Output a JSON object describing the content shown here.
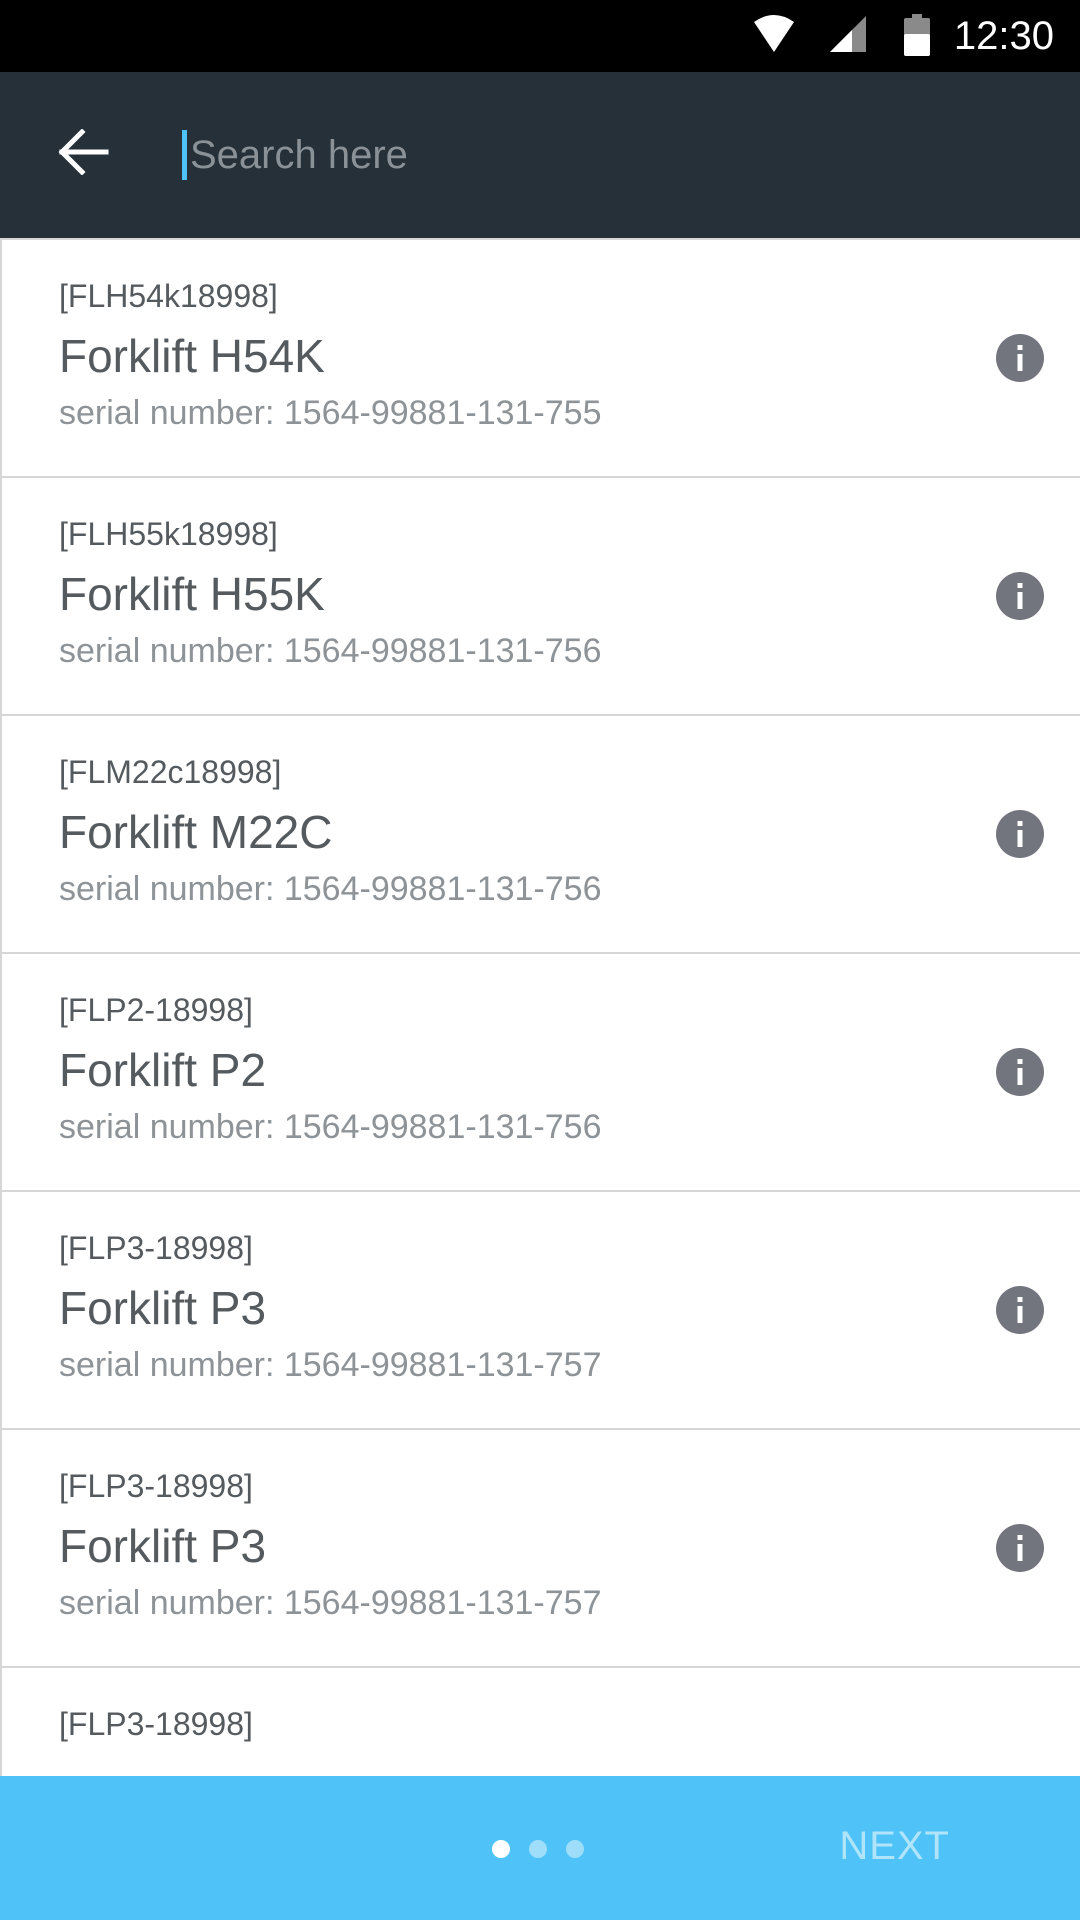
{
  "status_bar": {
    "time": "12:30",
    "icons": [
      "wifi-icon",
      "cell-signal-icon",
      "battery-icon"
    ]
  },
  "search": {
    "placeholder": "Search here",
    "value": "",
    "back_icon": "arrow-back-icon"
  },
  "items": [
    {
      "code": "[FLH54k18998]",
      "name": "Forklift H54K",
      "serial": "serial number: 1564-99881-131-755"
    },
    {
      "code": "[FLH55k18998]",
      "name": "Forklift H55K",
      "serial": "serial number: 1564-99881-131-756"
    },
    {
      "code": "[FLM22c18998]",
      "name": "Forklift M22C",
      "serial": "serial number: 1564-99881-131-756"
    },
    {
      "code": "[FLP2-18998]",
      "name": "Forklift P2",
      "serial": "serial number: 1564-99881-131-756"
    },
    {
      "code": "[FLP3-18998]",
      "name": "Forklift P3",
      "serial": "serial number: 1564-99881-131-757"
    },
    {
      "code": "[FLP3-18998]",
      "name": "Forklift P3",
      "serial": "serial number: 1564-99881-131-757"
    },
    {
      "code": "[FLP3-18998]",
      "name": "",
      "serial": ""
    }
  ],
  "footer": {
    "next_label": "NEXT",
    "pages": 3,
    "current_page": 1
  },
  "colors": {
    "app_bar": "#263038",
    "accent": "#4fc3f7",
    "info_icon": "#73757e"
  }
}
